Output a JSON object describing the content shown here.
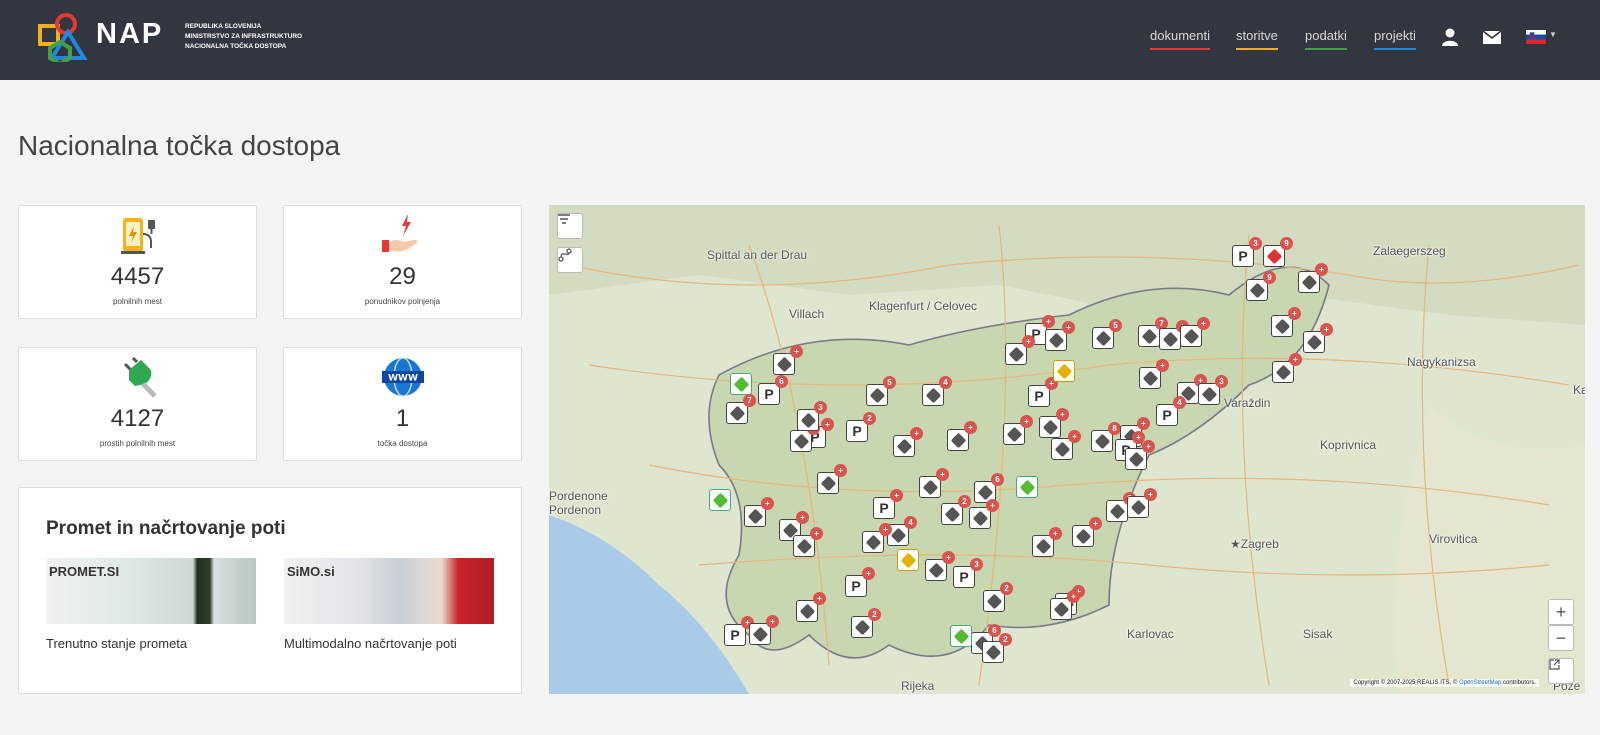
{
  "header": {
    "logo_text": "NAP",
    "ministry_lines": [
      "REPUBLIKA SLOVENIJA",
      "MINISTRSTVO ZA INFRASTRUKTURO",
      "NACIONALNA TOČKA DOSTOPA"
    ],
    "nav": [
      "dokumenti",
      "storitve",
      "podatki",
      "projekti"
    ]
  },
  "page_title": "Nacionalna točka dostopa",
  "stats": [
    {
      "value": "4457",
      "label": "polnilnih mest",
      "icon": "charging-station-icon"
    },
    {
      "value": "29",
      "label": "ponudnikov polnjenja",
      "icon": "energy-hand-icon"
    },
    {
      "value": "4127",
      "label": "prostih polnilnih mest",
      "icon": "plug-icon"
    },
    {
      "value": "1",
      "label": "točka dostopa",
      "icon": "www-globe-icon"
    }
  ],
  "promet": {
    "title": "Promet in načrtovanje poti",
    "tiles": [
      {
        "name": "PROMET.SI",
        "caption": "Trenutno stanje prometa"
      },
      {
        "name": "SiMO.si",
        "caption": "Multimodalno načrtovanje poti"
      }
    ]
  },
  "map": {
    "cities": [
      "Spittal an der Drau",
      "Villach",
      "Klagenfurt / Celovec",
      "Zalaegerszeg",
      "Nagykanizsa",
      "Varaždin",
      "Koprivnica",
      "Pordenone Pordenon",
      "★Zagreb",
      "Virovitica",
      "Karlovac",
      "Sisak",
      "Rijeka",
      "Ka",
      "Pože"
    ],
    "copyright_prefix": "Copyright © 2007-2025 REALIS ITS, © ",
    "copyright_link": "OpenStreetMap",
    "copyright_suffix": " contributors.",
    "zoom_in": "+",
    "zoom_out": "−",
    "markers": [
      {
        "t": "P",
        "b": "3"
      },
      {
        "t": "red",
        "b": "9"
      },
      {
        "t": "plug",
        "b": "+"
      },
      {
        "t": "plug",
        "b": "+"
      },
      {
        "t": "plug",
        "b": "9"
      },
      {
        "t": "P",
        "b": "+"
      },
      {
        "t": "plug",
        "b": "+"
      },
      {
        "t": "plug",
        "b": "+"
      },
      {
        "t": "plug",
        "b": "5"
      },
      {
        "t": "plug",
        "b": "7"
      },
      {
        "t": "plug",
        "b": "+"
      },
      {
        "t": "plug",
        "b": "+"
      },
      {
        "t": "P",
        "b": "+"
      },
      {
        "t": "yellow",
        "b": ""
      },
      {
        "t": "plug",
        "b": "+"
      },
      {
        "t": "plug",
        "b": "+"
      },
      {
        "t": "plug",
        "b": "3"
      },
      {
        "t": "plug",
        "b": "+"
      },
      {
        "t": "plug",
        "b": "+"
      },
      {
        "t": "green",
        "b": ""
      },
      {
        "t": "P",
        "b": "6"
      },
      {
        "t": "plug",
        "b": "7"
      },
      {
        "t": "plug",
        "b": "+"
      },
      {
        "t": "plug",
        "b": "5"
      },
      {
        "t": "plug",
        "b": "4"
      },
      {
        "t": "P",
        "b": "+"
      },
      {
        "t": "plug",
        "b": "+"
      },
      {
        "t": "plug",
        "b": "3"
      },
      {
        "t": "P",
        "b": "2"
      },
      {
        "t": "plug",
        "b": "+"
      },
      {
        "t": "plug",
        "b": "+"
      },
      {
        "t": "plug",
        "b": "+"
      },
      {
        "t": "P",
        "b": "4"
      },
      {
        "t": "plug",
        "b": "+"
      },
      {
        "t": "plug",
        "b": "8"
      },
      {
        "t": "plug",
        "b": "+"
      },
      {
        "t": "P",
        "b": "+"
      },
      {
        "t": "plug",
        "b": "+"
      },
      {
        "t": "plug",
        "b": "+"
      },
      {
        "t": "plug",
        "b": "+"
      },
      {
        "t": "plug",
        "b": "6"
      },
      {
        "t": "green",
        "b": ""
      },
      {
        "t": "plug",
        "b": "+"
      },
      {
        "t": "green",
        "b": ""
      },
      {
        "t": "plug",
        "b": "+"
      },
      {
        "t": "plug",
        "b": "+"
      },
      {
        "t": "P",
        "b": "+"
      },
      {
        "t": "plug",
        "b": "2"
      },
      {
        "t": "plug",
        "b": "+"
      },
      {
        "t": "plug",
        "b": "8"
      },
      {
        "t": "plug",
        "b": "+"
      },
      {
        "t": "plug",
        "b": "4"
      },
      {
        "t": "plug",
        "b": "+"
      },
      {
        "t": "plug",
        "b": "+"
      },
      {
        "t": "plug",
        "b": "+"
      },
      {
        "t": "plug",
        "b": "+"
      },
      {
        "t": "yellow",
        "b": ""
      },
      {
        "t": "plug",
        "b": "+"
      },
      {
        "t": "P",
        "b": "3"
      },
      {
        "t": "P",
        "b": "+"
      },
      {
        "t": "plug",
        "b": "+"
      },
      {
        "t": "P",
        "b": "+"
      },
      {
        "t": "plug",
        "b": "+"
      },
      {
        "t": "plug",
        "b": "2"
      },
      {
        "t": "plug",
        "b": "6"
      },
      {
        "t": "plug",
        "b": "2"
      },
      {
        "t": "plug",
        "b": "+"
      },
      {
        "t": "green",
        "b": ""
      },
      {
        "t": "plug",
        "b": "2"
      },
      {
        "t": "plug",
        "b": "+"
      }
    ]
  }
}
